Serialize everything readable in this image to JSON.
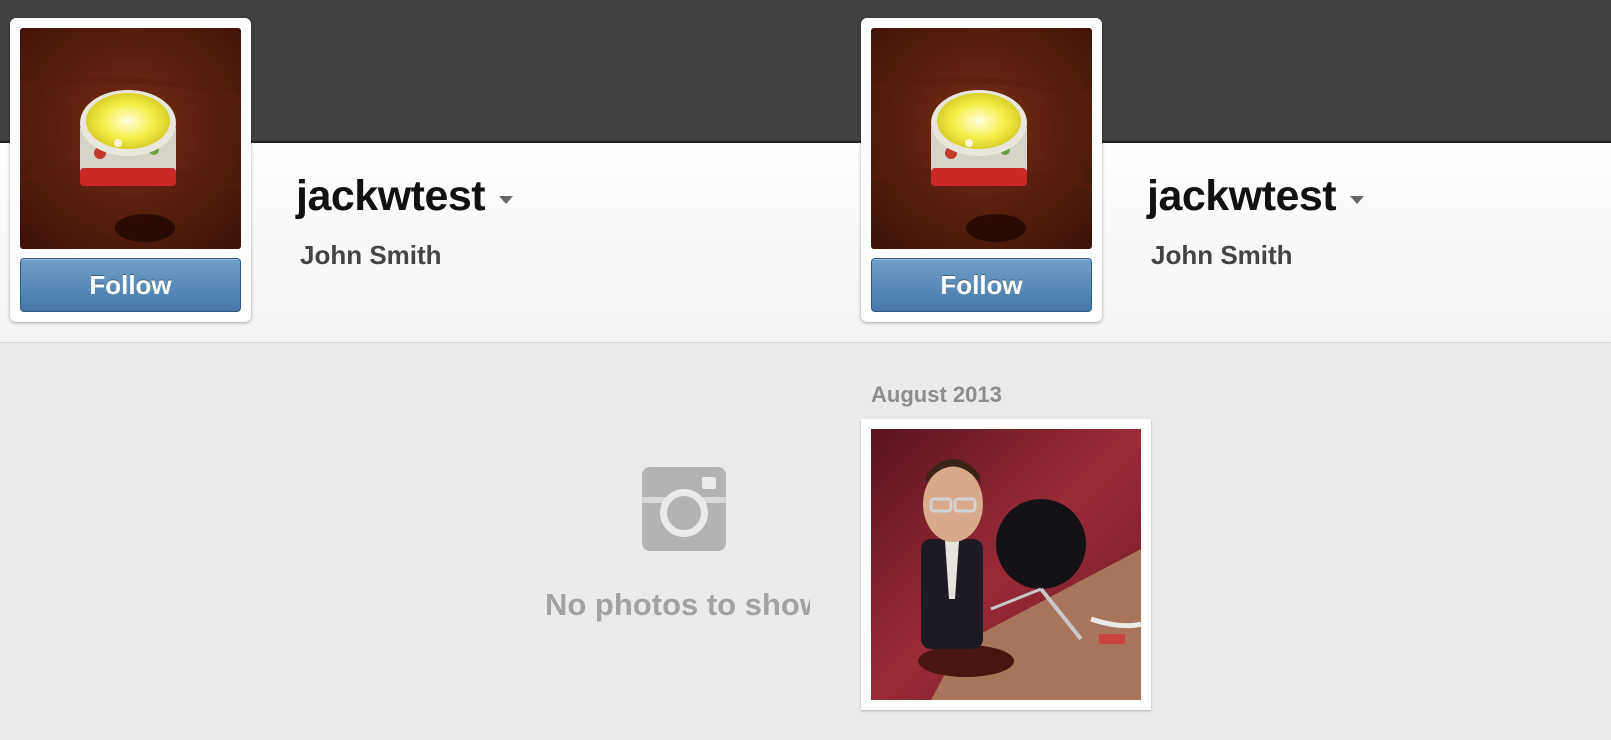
{
  "left_profile": {
    "username": "jackwtest",
    "full_name": "John Smith",
    "follow_label": "Follow",
    "avatar_icon": "candle-photo",
    "empty_state": {
      "icon": "camera-icon",
      "message": "No photos to show"
    }
  },
  "right_profile": {
    "username": "jackwtest",
    "full_name": "John Smith",
    "follow_label": "Follow",
    "avatar_icon": "candle-photo",
    "photo_group": {
      "month": "August 2013",
      "photo_icon": "bobblehead-photo"
    }
  },
  "colors": {
    "top_bar": "#414141",
    "follow_button": "#5a8bbb",
    "page_background": "#ebebeb"
  }
}
